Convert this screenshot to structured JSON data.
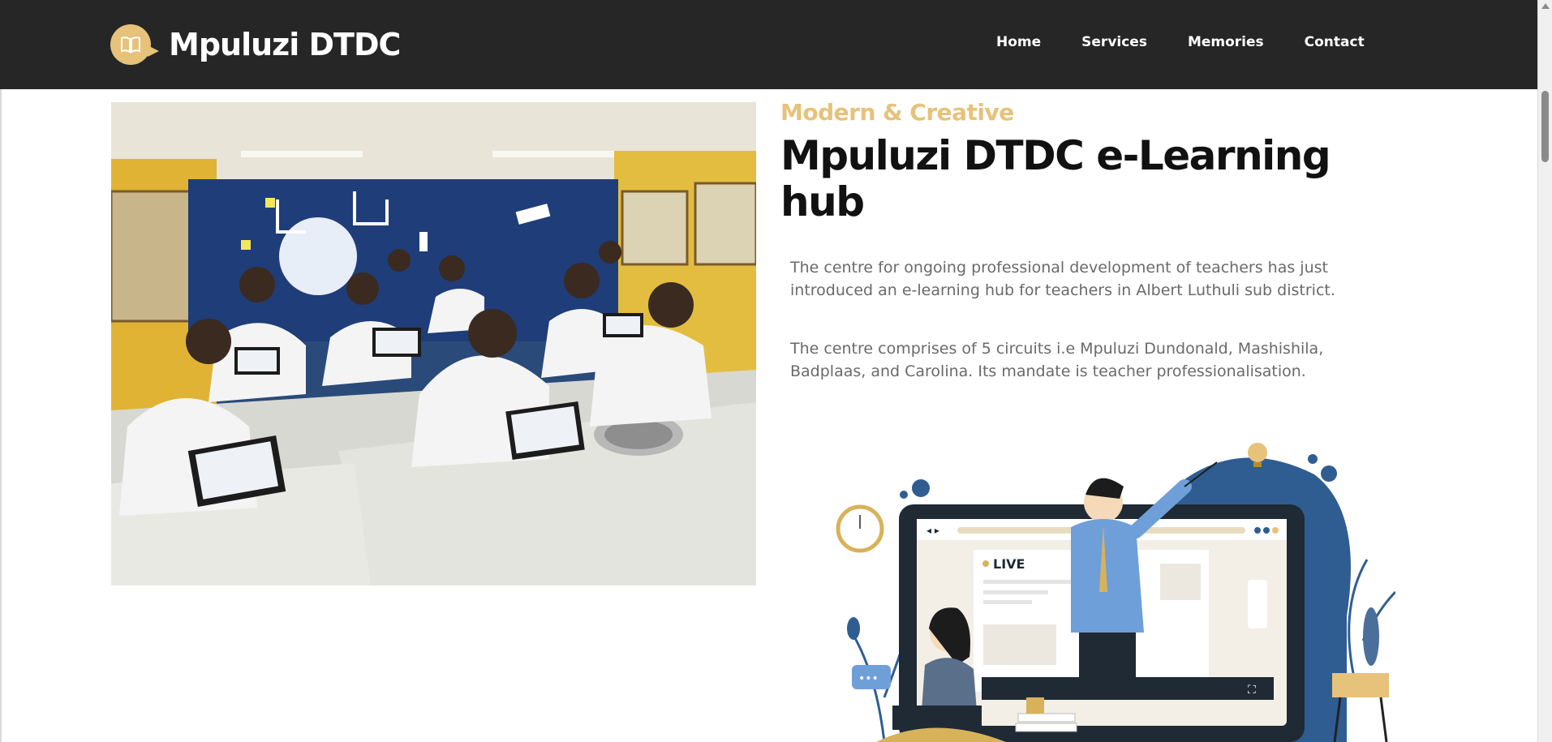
{
  "brand": {
    "name": "Mpuluzi DTDC",
    "logo_icon": "open-book-icon",
    "accent_color": "#e6c27a"
  },
  "nav": {
    "items": [
      "Home",
      "Services",
      "Memories",
      "Contact"
    ]
  },
  "hero": {
    "eyebrow": "Modern & Creative",
    "title": "Mpuluzi DTDC e-Learning hub",
    "paragraphs": [
      "The centre for ongoing professional development of teachers has just introduced an e-learning hub for teachers in Albert Luthuli sub district.",
      "The centre comprises of 5 circuits i.e Mpuluzi Dundonald, Mashishila, Badplaas, and Carolina. Its mandate is teacher professionalisation."
    ],
    "illustration_label": "LIVE"
  },
  "colors": {
    "navbar_bg": "#262626",
    "text_dark": "#111111",
    "text_muted": "#6a6a6a"
  }
}
